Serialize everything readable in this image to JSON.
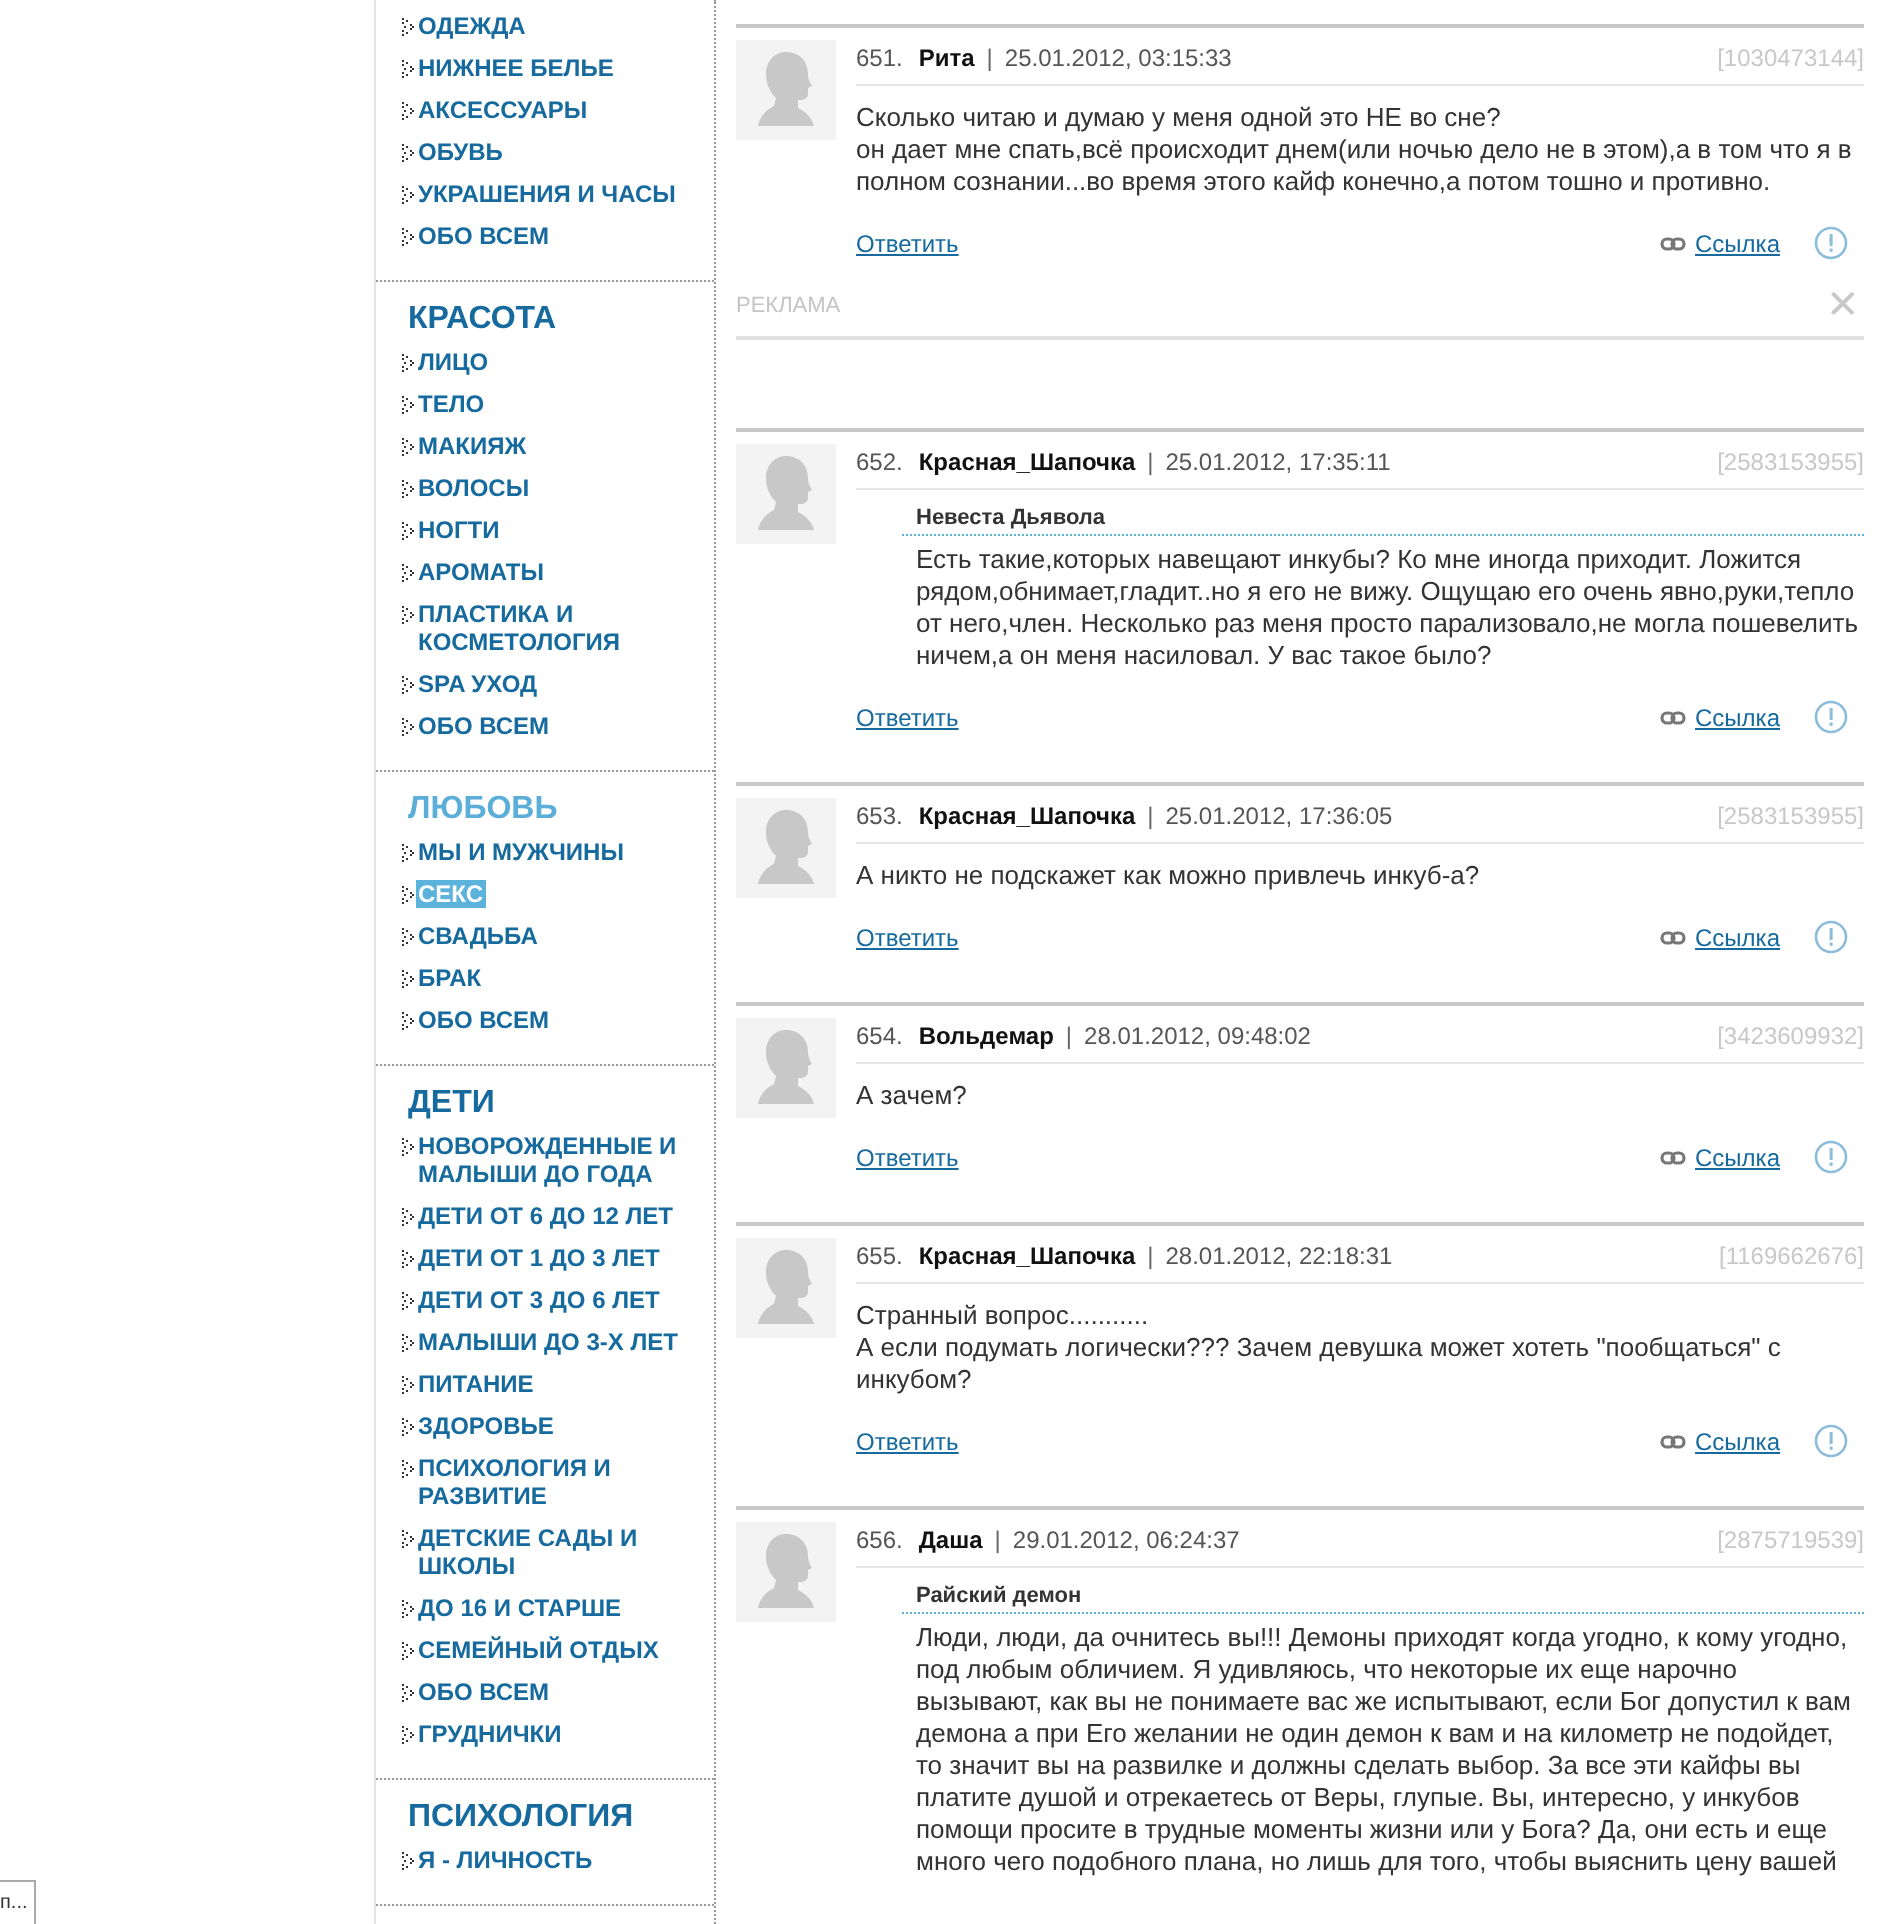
{
  "sidebar": {
    "sections": [
      {
        "items": [
          {
            "label": "ОДЕЖДА",
            "selected": false
          },
          {
            "label": "НИЖНЕЕ БЕЛЬЕ",
            "selected": false
          },
          {
            "label": "АКСЕССУАРЫ",
            "selected": false
          },
          {
            "label": "ОБУВЬ",
            "selected": false
          },
          {
            "label": "УКРАШЕНИЯ И ЧАСЫ",
            "selected": false
          },
          {
            "label": "ОБО ВСЕМ",
            "selected": false
          }
        ]
      },
      {
        "title": "КРАСОТА",
        "active": false,
        "items": [
          {
            "label": "ЛИЦО",
            "selected": false
          },
          {
            "label": "ТЕЛО",
            "selected": false
          },
          {
            "label": "МАКИЯЖ",
            "selected": false
          },
          {
            "label": "ВОЛОСЫ",
            "selected": false
          },
          {
            "label": "НОГТИ",
            "selected": false
          },
          {
            "label": "АРОМАТЫ",
            "selected": false
          },
          {
            "label": "ПЛАСТИКА И КОСМЕТОЛОГИЯ",
            "selected": false
          },
          {
            "label": "SPA УХОД",
            "selected": false
          },
          {
            "label": "ОБО ВСЕМ",
            "selected": false
          }
        ]
      },
      {
        "title": "ЛЮБОВЬ",
        "active": true,
        "items": [
          {
            "label": "МЫ И МУЖЧИНЫ",
            "selected": false
          },
          {
            "label": "СЕКС",
            "selected": true
          },
          {
            "label": "СВАДЬБА",
            "selected": false
          },
          {
            "label": "БРАК",
            "selected": false
          },
          {
            "label": "ОБО ВСЕМ",
            "selected": false
          }
        ]
      },
      {
        "title": "ДЕТИ",
        "active": false,
        "items": [
          {
            "label": "НОВОРОЖДЕННЫЕ И МАЛЫШИ ДО ГОДА",
            "selected": false
          },
          {
            "label": "ДЕТИ ОТ 6 ДО 12 ЛЕТ",
            "selected": false
          },
          {
            "label": "ДЕТИ ОТ 1 ДО 3 ЛЕТ",
            "selected": false
          },
          {
            "label": "ДЕТИ ОТ 3 ДО 6 ЛЕТ",
            "selected": false
          },
          {
            "label": "МАЛЫШИ ДО 3-Х ЛЕТ",
            "selected": false
          },
          {
            "label": "ПИТАНИЕ",
            "selected": false
          },
          {
            "label": "ЗДОРОВЬЕ",
            "selected": false
          },
          {
            "label": "ПСИХОЛОГИЯ И РАЗВИТИЕ",
            "selected": false
          },
          {
            "label": "ДЕТСКИЕ САДЫ И ШКОЛЫ",
            "selected": false
          },
          {
            "label": "ДО 16 И СТАРШЕ",
            "selected": false
          },
          {
            "label": "СЕМЕЙНЫЙ ОТДЫХ",
            "selected": false
          },
          {
            "label": "ОБО ВСЕМ",
            "selected": false
          },
          {
            "label": "ГРУДНИЧКИ",
            "selected": false
          }
        ]
      },
      {
        "title": "ПСИХОЛОГИЯ",
        "active": false,
        "items": [
          {
            "label": "Я - ЛИЧНОСТЬ",
            "selected": false
          }
        ]
      }
    ]
  },
  "feed": [
    {
      "kind": "comment",
      "number": "651.",
      "author": "Рита",
      "separator": "|",
      "date": "25.01.2012, 03:15:33",
      "id": "[1030473144]",
      "text": "Сколько читаю и думаю у меня одной это НЕ во сне?\nон дает мне спать,всё происходит днем(или ночью дело не в этом),а в том что я в полном сознании...во время этого кайф конечно,а потом тошно и противно.",
      "reply": "Ответить",
      "link": "Ссылка"
    },
    {
      "kind": "ad",
      "label": "РЕКЛАМА",
      "close": "✕"
    },
    {
      "kind": "comment",
      "number": "652.",
      "author": "Красная_Шапочка",
      "separator": "|",
      "date": "25.01.2012, 17:35:11",
      "id": "[2583153955]",
      "quote_author": "Невеста Дьявола",
      "quote": "Есть такие,которых навещают инкубы? Ко мне иногда приходит. Ложится рядом,обнимает,гладит..но я его не вижу. Ощущаю его очень явно,руки,тепло от него,член. Несколько раз меня просто парализовало,не могла пошевелить ничем,а он меня насиловал. У вас такое было?",
      "reply": "Ответить",
      "link": "Ссылка"
    },
    {
      "kind": "comment",
      "number": "653.",
      "author": "Красная_Шапочка",
      "separator": "|",
      "date": "25.01.2012, 17:36:05",
      "id": "[2583153955]",
      "text": "А никто не подскажет как можно привлечь инкуб-а?",
      "reply": "Ответить",
      "link": "Ссылка"
    },
    {
      "kind": "comment",
      "number": "654.",
      "author": "Вольдемар",
      "separator": "|",
      "date": "28.01.2012, 09:48:02",
      "id": "[3423609932]",
      "text": "А зачем?",
      "reply": "Ответить",
      "link": "Ссылка"
    },
    {
      "kind": "comment",
      "number": "655.",
      "author": "Красная_Шапочка",
      "separator": "|",
      "date": "28.01.2012, 22:18:31",
      "id": "[1169662676]",
      "text": "Странный вопрос...........\nА если подумать логически??? Зачем девушка может хотеть \"пообщаться\" с инкубом?",
      "reply": "Ответить",
      "link": "Ссылка"
    },
    {
      "kind": "comment",
      "number": "656.",
      "author": "Даша",
      "separator": "|",
      "date": "29.01.2012, 06:24:37",
      "id": "[2875719539]",
      "quote_author": "Райский демон",
      "quote": "Люди, люди, да очнитесь вы!!! Демоны приходят когда угодно, к кому угодно, под любым обличием. Я удивляюсь, что некоторые их еще нарочно вызывают, как вы не понимаете вас же испытывают, если Бог допустил к вам демона а при Его желании не один демон к вам и на километр не подойдет, то значит вы на развилке и должны сделать выбор. За все эти кайфы вы платите душой и отрекаетесь от Веры, глупые. Вы, интересно, у инкубов помощи просите в трудные моменты жизни или у Бога? Да, они есть и еще много чего подобного плана, но лишь для того, чтобы выяснить цену вашей"
    }
  ],
  "corner_tooltip": "п..."
}
